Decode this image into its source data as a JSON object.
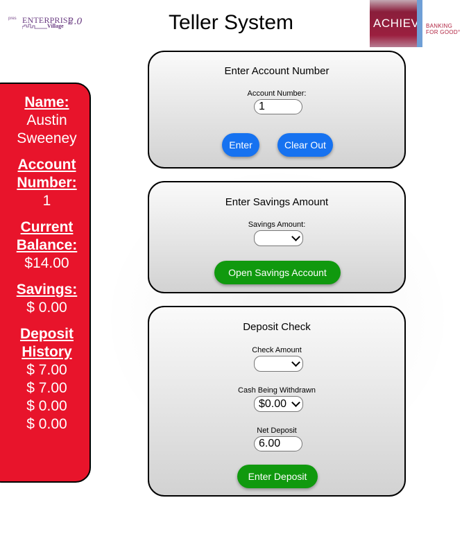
{
  "header": {
    "title": "Teller System",
    "enterprise_logo": {
      "pre": "pres",
      "main": "ENTERPRISE",
      "sub": "Village",
      "version": "2.0"
    },
    "achieva_logo": {
      "name": "ACHIEVA",
      "tagline": "BANKING FOR GOOD°"
    }
  },
  "customer": {
    "name_label": "Name:",
    "name": "Austin Sweeney",
    "account_label": "Account Number:",
    "account_number": "1",
    "balance_label": "Current Balance:",
    "balance": "$14.00",
    "savings_label": "Savings:",
    "savings": "$ 0.00",
    "deposit_history_label": "Deposit History",
    "deposit_history": [
      "$ 7.00",
      "$ 7.00",
      "$ 0.00",
      "$ 0.00"
    ]
  },
  "account_card": {
    "title": "Enter Account Number",
    "field_label": "Account Number:",
    "field_value": "1",
    "enter_button": "Enter",
    "clear_button": "Clear Out"
  },
  "savings_card": {
    "title": "Enter Savings Amount",
    "field_label": "Savings Amount:",
    "selected_value": "",
    "open_button": "Open Savings Account"
  },
  "deposit_card": {
    "title": "Deposit Check",
    "check_label": "Check Amount",
    "check_value": "",
    "cash_label": "Cash Being Withdrawn",
    "cash_value": "$0.00",
    "net_label": "Net Deposit",
    "net_value": "6.00",
    "deposit_button": "Enter Deposit"
  },
  "colors": {
    "panel_red": "#e8142b",
    "button_blue": "#1672f0",
    "button_green": "#10990e"
  }
}
